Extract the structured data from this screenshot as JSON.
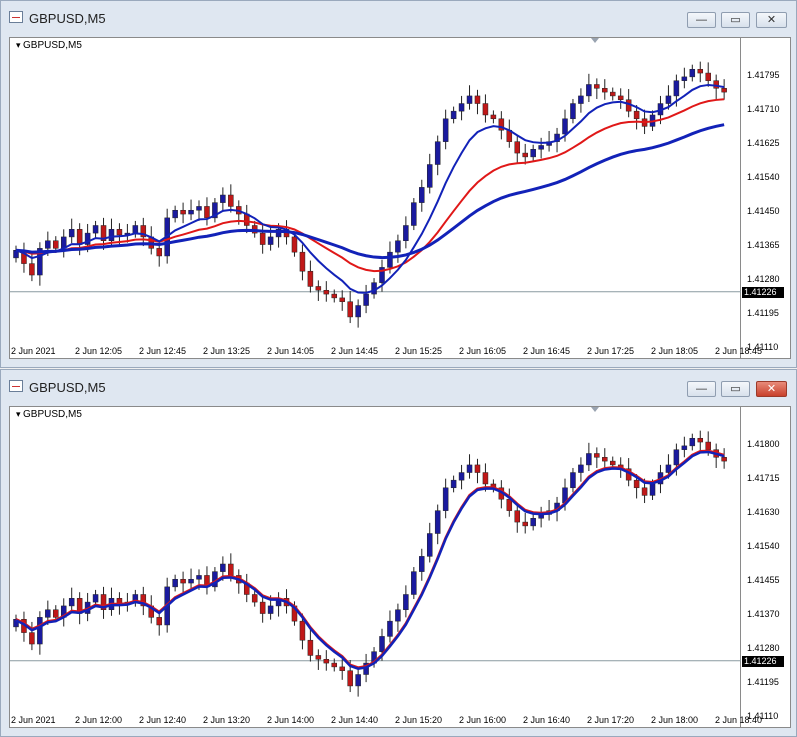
{
  "windows": [
    {
      "title": "GBPUSD,M5",
      "chart_label": "GBPUSD,M5",
      "current_price": "1.41226",
      "price_labels": [
        "1.41795",
        "1.41710",
        "1.41625",
        "1.41540",
        "1.41450",
        "1.41365",
        "1.41280",
        "1.41195",
        "1.41110"
      ],
      "time_labels": [
        "2 Jun 2021",
        "2 Jun 12:05",
        "2 Jun 12:45",
        "2 Jun 13:25",
        "2 Jun 14:05",
        "2 Jun 14:45",
        "2 Jun 15:25",
        "2 Jun 16:05",
        "2 Jun 16:45",
        "2 Jun 17:25",
        "2 Jun 18:05",
        "2 Jun 18:45"
      ]
    },
    {
      "title": "GBPUSD,M5",
      "chart_label": "GBPUSD,M5",
      "current_price": "1.41226",
      "price_labels": [
        "1.41800",
        "1.41715",
        "1.41630",
        "1.41540",
        "1.41455",
        "1.41370",
        "1.41280",
        "1.41195",
        "1.41110"
      ],
      "time_labels": [
        "2 Jun 2021",
        "2 Jun 12:00",
        "2 Jun 12:40",
        "2 Jun 13:20",
        "2 Jun 14:00",
        "2 Jun 14:40",
        "2 Jun 15:20",
        "2 Jun 16:00",
        "2 Jun 16:40",
        "2 Jun 17:20",
        "2 Jun 18:00",
        "2 Jun 18:40"
      ]
    }
  ],
  "controls": {
    "minimize": "—",
    "restore": "▭",
    "close": "✕"
  },
  "colors": {
    "bull": "#1a1a9e",
    "bear": "#c01818",
    "ma_red": "#e01818",
    "ma_blue": "#1222b8",
    "grid_line": "#8a9aa0"
  },
  "chart_data": [
    {
      "type": "candlestick",
      "symbol": "GBPUSD",
      "timeframe": "M5",
      "ylim": [
        1.4111,
        1.4185
      ],
      "close": [
        1.41335,
        1.413,
        1.4127,
        1.4134,
        1.4136,
        1.4134,
        1.4137,
        1.4139,
        1.4135,
        1.4138,
        1.414,
        1.4136,
        1.4139,
        1.41375,
        1.4138,
        1.414,
        1.4137,
        1.4134,
        1.4132,
        1.4142,
        1.4144,
        1.4143,
        1.4144,
        1.4145,
        1.4142,
        1.4146,
        1.4148,
        1.4145,
        1.4143,
        1.414,
        1.4138,
        1.4135,
        1.4137,
        1.4139,
        1.4137,
        1.4133,
        1.4128,
        1.4124,
        1.4123,
        1.4122,
        1.4121,
        1.412,
        1.4116,
        1.4119,
        1.4122,
        1.4125,
        1.4129,
        1.4133,
        1.4136,
        1.414,
        1.4146,
        1.415,
        1.4156,
        1.4162,
        1.4168,
        1.417,
        1.4172,
        1.4174,
        1.4172,
        1.4169,
        1.4168,
        1.4165,
        1.4162,
        1.4159,
        1.4158,
        1.416,
        1.4161,
        1.4162,
        1.4164,
        1.4168,
        1.4172,
        1.4174,
        1.4177,
        1.4176,
        1.4175,
        1.4174,
        1.4173,
        1.417,
        1.4168,
        1.4166,
        1.4169,
        1.4172,
        1.4174,
        1.4178,
        1.4179,
        1.4181,
        1.418,
        1.4178,
        1.4176,
        1.4175
      ]
    },
    {
      "type": "candlestick",
      "symbol": "GBPUSD",
      "timeframe": "M5",
      "ylim": [
        1.4111,
        1.4185
      ]
    }
  ]
}
